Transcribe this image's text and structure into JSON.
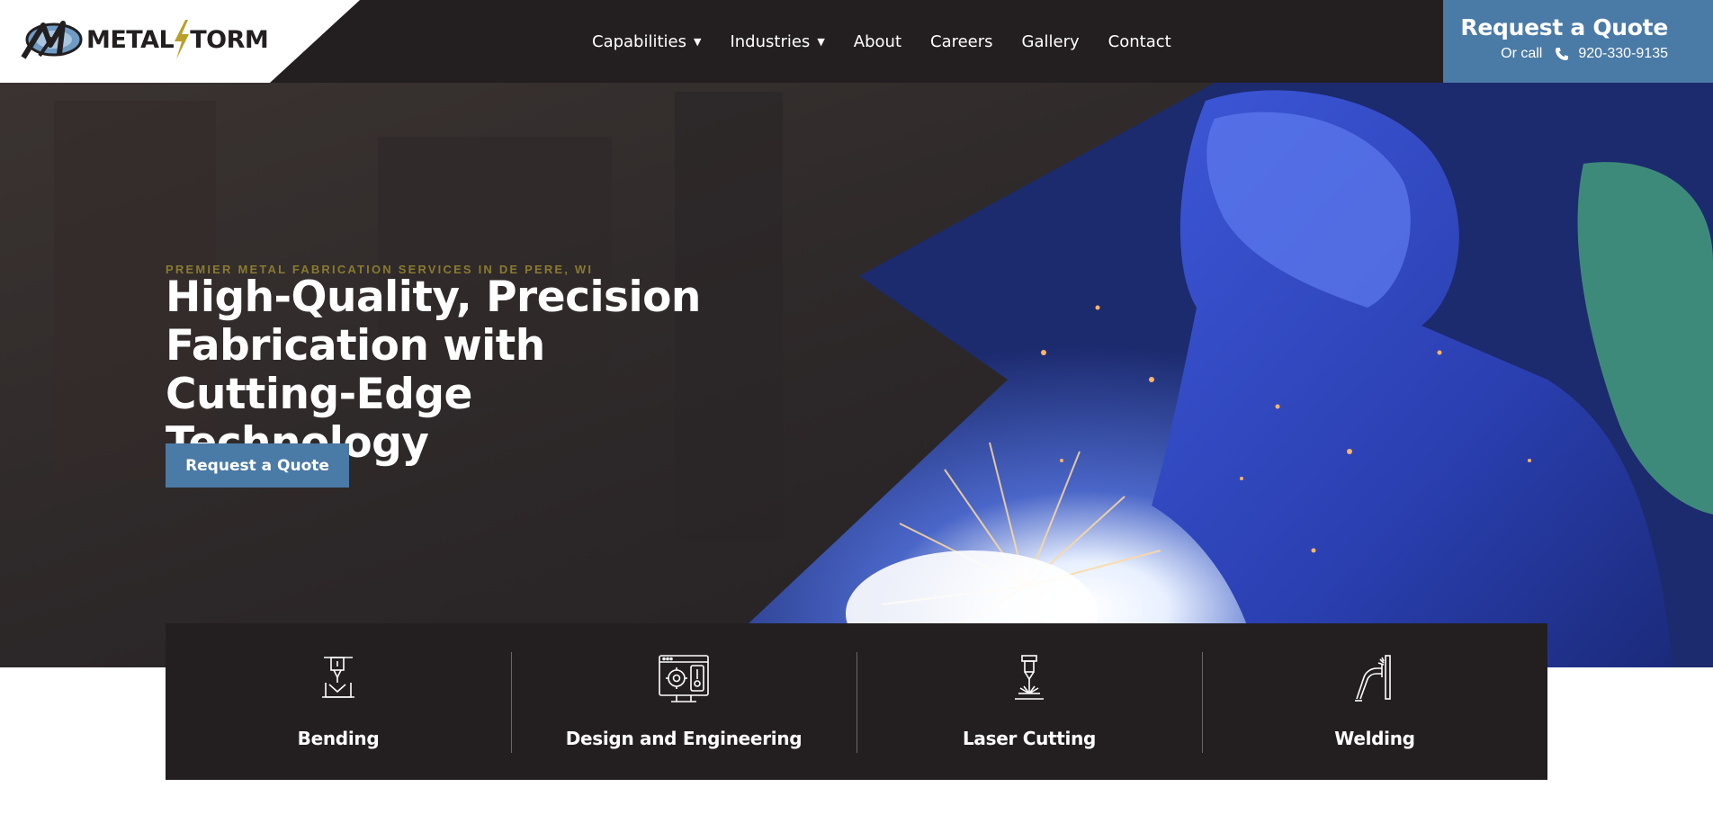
{
  "brand": {
    "name_left": "METAL",
    "name_right": "TORM",
    "colors": {
      "dark": "#231f20",
      "accent_blue": "#4a7aa6",
      "gold": "#b8a02a"
    }
  },
  "nav": {
    "items": [
      {
        "label": "Capabilities",
        "has_dropdown": true
      },
      {
        "label": "Industries",
        "has_dropdown": true
      },
      {
        "label": "About",
        "has_dropdown": false
      },
      {
        "label": "Careers",
        "has_dropdown": false
      },
      {
        "label": "Gallery",
        "has_dropdown": false
      },
      {
        "label": "Contact",
        "has_dropdown": false
      }
    ],
    "caret": "▼"
  },
  "quote_box": {
    "title": "Request a Quote",
    "call_label": "Or call",
    "phone": "920-330-9135",
    "icon": "phone-icon"
  },
  "hero": {
    "eyebrow": "PREMIER METAL FABRICATION SERVICES IN DE PERE, WI",
    "headline": "High-Quality, Precision Fabrication with Cutting-Edge Technology",
    "button_label": "Request a Quote"
  },
  "services": [
    {
      "label": "Bending",
      "icon": "bending-press-icon"
    },
    {
      "label": "Design and Engineering",
      "icon": "cad-monitor-icon"
    },
    {
      "label": "Laser Cutting",
      "icon": "laser-cutter-icon"
    },
    {
      "label": "Welding",
      "icon": "welding-torch-icon"
    }
  ]
}
